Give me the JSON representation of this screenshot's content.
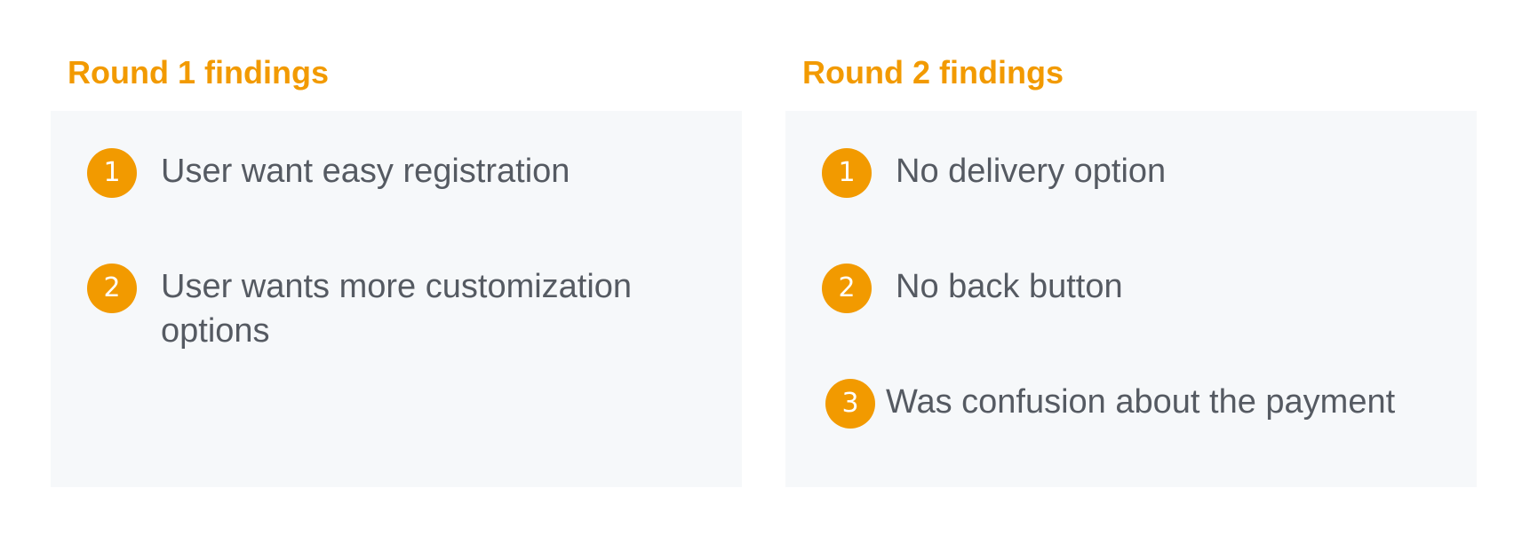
{
  "rounds": [
    {
      "title": "Round 1 findings",
      "items": [
        {
          "number": "1",
          "text": "User want easy registration"
        },
        {
          "number": "2",
          "text": "User wants more customization options"
        }
      ]
    },
    {
      "title": "Round 2 findings",
      "items": [
        {
          "number": "1",
          "text": "No delivery option"
        },
        {
          "number": "2",
          "text": "No back button"
        },
        {
          "number": "3",
          "text": "Was confusion about the payment"
        }
      ]
    }
  ],
  "colors": {
    "accent": "#f29a00",
    "panel_background": "#f6f8fa",
    "body_text": "#555a62"
  }
}
